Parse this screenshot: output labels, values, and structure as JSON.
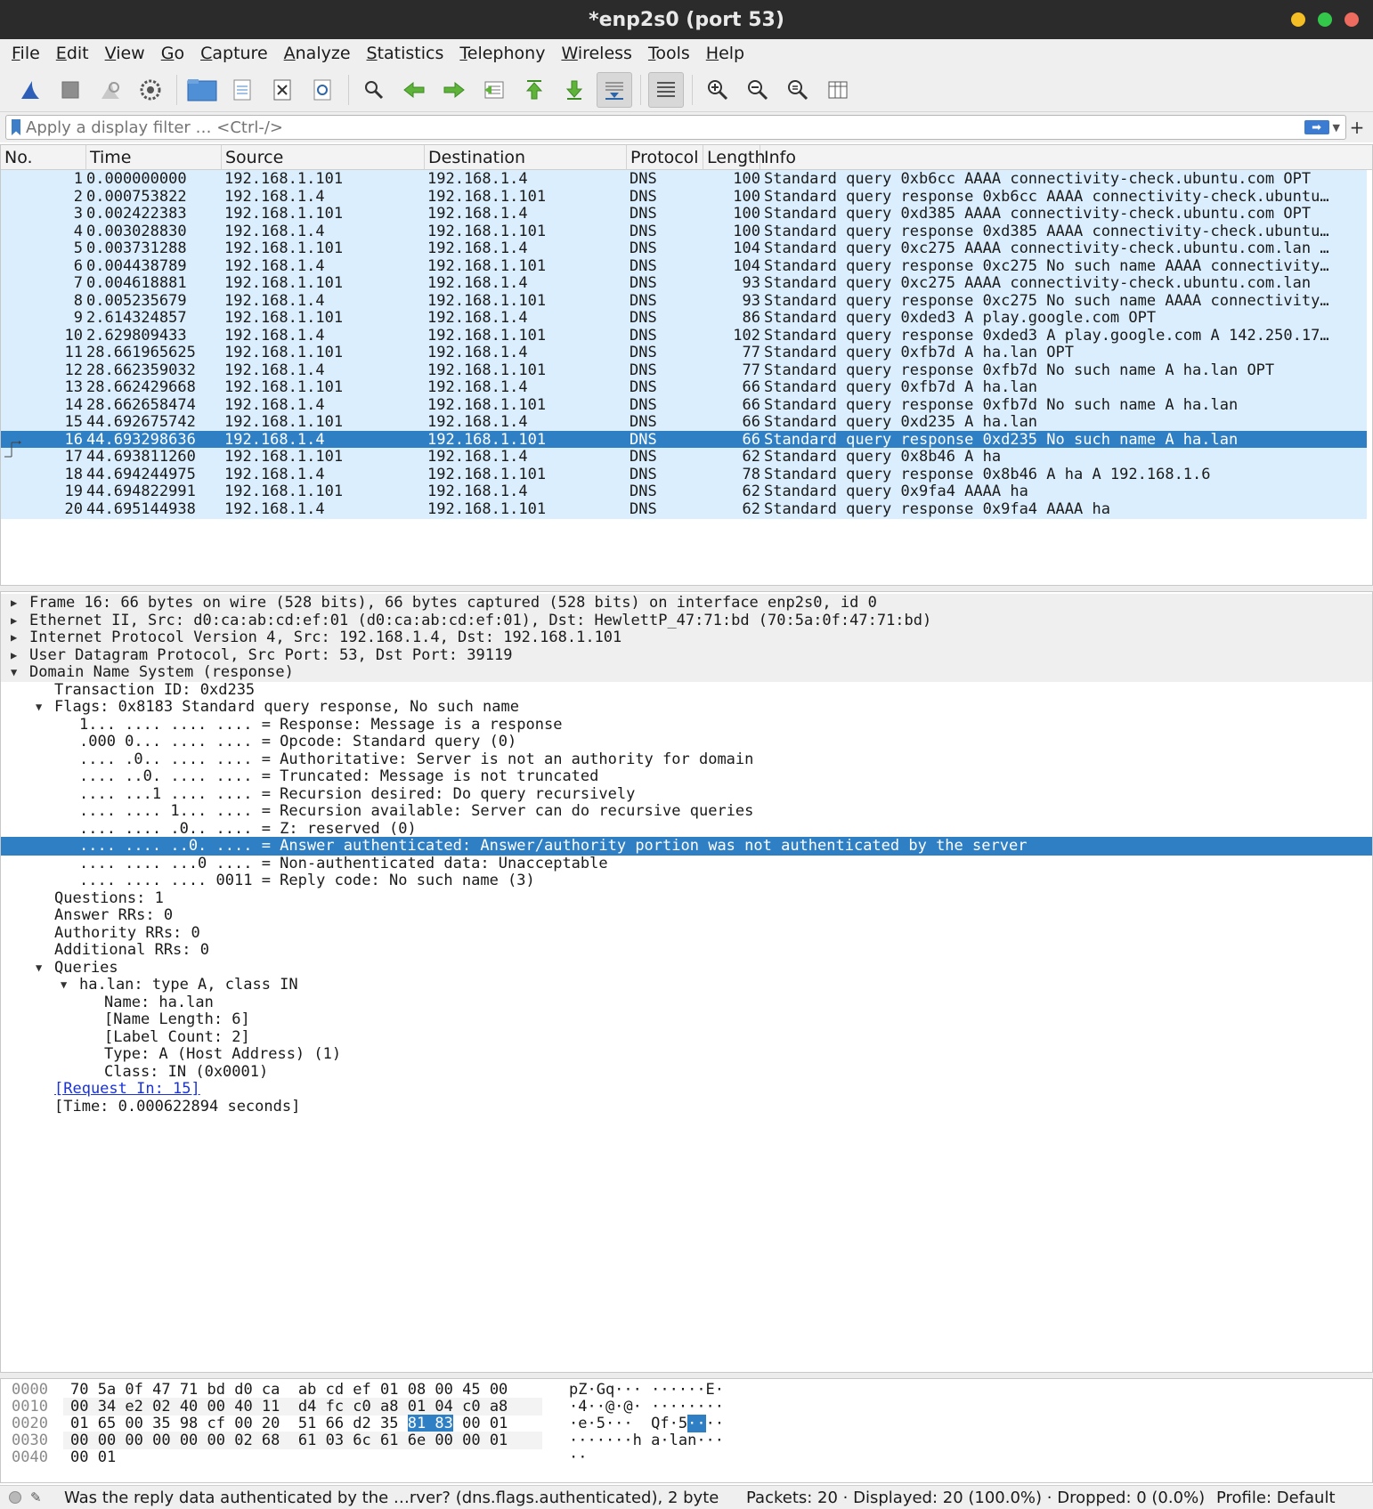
{
  "window": {
    "title": "*enp2s0 (port 53)",
    "colors": {
      "close": "#f4bf24",
      "max": "#34c84a",
      "min": "#ed6b5f"
    }
  },
  "menu": [
    {
      "label": "File",
      "u": "F",
      "rest": "ile"
    },
    {
      "label": "Edit",
      "u": "E",
      "rest": "dit"
    },
    {
      "label": "View",
      "u": "V",
      "rest": "iew"
    },
    {
      "label": "Go",
      "u": "G",
      "rest": "o"
    },
    {
      "label": "Capture",
      "u": "C",
      "rest": "apture"
    },
    {
      "label": "Analyze",
      "u": "A",
      "rest": "nalyze"
    },
    {
      "label": "Statistics",
      "u": "S",
      "rest": "tatistics"
    },
    {
      "label": "Telephony",
      "u": "T",
      "rest": "elephony"
    },
    {
      "label": "Wireless",
      "u": "W",
      "rest": "ireless"
    },
    {
      "label": "Tools",
      "u": "T",
      "rest": "ools"
    },
    {
      "label": "Help",
      "u": "H",
      "rest": "elp"
    }
  ],
  "filter": {
    "placeholder": "Apply a display filter … <Ctrl-/>"
  },
  "packet_list": {
    "columns": [
      "No.",
      "Time",
      "Source",
      "Destination",
      "Protocol",
      "Length",
      "Info"
    ],
    "selected_index": 15,
    "rows": [
      {
        "no": "1",
        "time": "0.000000000",
        "src": "192.168.1.101",
        "dst": "192.168.1.4",
        "proto": "DNS",
        "len": "100",
        "info": "Standard query 0xb6cc AAAA connectivity-check.ubuntu.com OPT"
      },
      {
        "no": "2",
        "time": "0.000753822",
        "src": "192.168.1.4",
        "dst": "192.168.1.101",
        "proto": "DNS",
        "len": "100",
        "info": "Standard query response 0xb6cc AAAA connectivity-check.ubuntu…"
      },
      {
        "no": "3",
        "time": "0.002422383",
        "src": "192.168.1.101",
        "dst": "192.168.1.4",
        "proto": "DNS",
        "len": "100",
        "info": "Standard query 0xd385 AAAA connectivity-check.ubuntu.com OPT"
      },
      {
        "no": "4",
        "time": "0.003028830",
        "src": "192.168.1.4",
        "dst": "192.168.1.101",
        "proto": "DNS",
        "len": "100",
        "info": "Standard query response 0xd385 AAAA connectivity-check.ubuntu…"
      },
      {
        "no": "5",
        "time": "0.003731288",
        "src": "192.168.1.101",
        "dst": "192.168.1.4",
        "proto": "DNS",
        "len": "104",
        "info": "Standard query 0xc275 AAAA connectivity-check.ubuntu.com.lan …"
      },
      {
        "no": "6",
        "time": "0.004438789",
        "src": "192.168.1.4",
        "dst": "192.168.1.101",
        "proto": "DNS",
        "len": "104",
        "info": "Standard query response 0xc275 No such name AAAA connectivity…"
      },
      {
        "no": "7",
        "time": "0.004618881",
        "src": "192.168.1.101",
        "dst": "192.168.1.4",
        "proto": "DNS",
        "len": "93",
        "info": "Standard query 0xc275 AAAA connectivity-check.ubuntu.com.lan"
      },
      {
        "no": "8",
        "time": "0.005235679",
        "src": "192.168.1.4",
        "dst": "192.168.1.101",
        "proto": "DNS",
        "len": "93",
        "info": "Standard query response 0xc275 No such name AAAA connectivity…"
      },
      {
        "no": "9",
        "time": "2.614324857",
        "src": "192.168.1.101",
        "dst": "192.168.1.4",
        "proto": "DNS",
        "len": "86",
        "info": "Standard query 0xded3 A play.google.com OPT"
      },
      {
        "no": "10",
        "time": "2.629809433",
        "src": "192.168.1.4",
        "dst": "192.168.1.101",
        "proto": "DNS",
        "len": "102",
        "info": "Standard query response 0xded3 A play.google.com A 142.250.17…"
      },
      {
        "no": "11",
        "time": "28.661965625",
        "src": "192.168.1.101",
        "dst": "192.168.1.4",
        "proto": "DNS",
        "len": "77",
        "info": "Standard query 0xfb7d A ha.lan OPT"
      },
      {
        "no": "12",
        "time": "28.662359032",
        "src": "192.168.1.4",
        "dst": "192.168.1.101",
        "proto": "DNS",
        "len": "77",
        "info": "Standard query response 0xfb7d No such name A ha.lan OPT"
      },
      {
        "no": "13",
        "time": "28.662429668",
        "src": "192.168.1.101",
        "dst": "192.168.1.4",
        "proto": "DNS",
        "len": "66",
        "info": "Standard query 0xfb7d A ha.lan"
      },
      {
        "no": "14",
        "time": "28.662658474",
        "src": "192.168.1.4",
        "dst": "192.168.1.101",
        "proto": "DNS",
        "len": "66",
        "info": "Standard query response 0xfb7d No such name A ha.lan"
      },
      {
        "no": "15",
        "time": "44.692675742",
        "src": "192.168.1.101",
        "dst": "192.168.1.4",
        "proto": "DNS",
        "len": "66",
        "info": "Standard query 0xd235 A ha.lan"
      },
      {
        "no": "16",
        "time": "44.693298636",
        "src": "192.168.1.4",
        "dst": "192.168.1.101",
        "proto": "DNS",
        "len": "66",
        "info": "Standard query response 0xd235 No such name A ha.lan"
      },
      {
        "no": "17",
        "time": "44.693811260",
        "src": "192.168.1.101",
        "dst": "192.168.1.4",
        "proto": "DNS",
        "len": "62",
        "info": "Standard query 0x8b46 A ha"
      },
      {
        "no": "18",
        "time": "44.694244975",
        "src": "192.168.1.4",
        "dst": "192.168.1.101",
        "proto": "DNS",
        "len": "78",
        "info": "Standard query response 0x8b46 A ha A 192.168.1.6"
      },
      {
        "no": "19",
        "time": "44.694822991",
        "src": "192.168.1.101",
        "dst": "192.168.1.4",
        "proto": "DNS",
        "len": "62",
        "info": "Standard query 0x9fa4 AAAA ha"
      },
      {
        "no": "20",
        "time": "44.695144938",
        "src": "192.168.1.4",
        "dst": "192.168.1.101",
        "proto": "DNS",
        "len": "62",
        "info": "Standard query response 0x9fa4 AAAA ha"
      }
    ]
  },
  "detail": [
    {
      "text": "Frame 16: 66 bytes on wire (528 bits), 66 bytes captured (528 bits) on interface enp2s0, id 0",
      "level": 0,
      "arrow": "collapsed",
      "top": true
    },
    {
      "text": "Ethernet II, Src: d0:ca:ab:cd:ef:01 (d0:ca:ab:cd:ef:01), Dst: HewlettP_47:71:bd (70:5a:0f:47:71:bd)",
      "level": 0,
      "arrow": "collapsed",
      "top": true
    },
    {
      "text": "Internet Protocol Version 4, Src: 192.168.1.4, Dst: 192.168.1.101",
      "level": 0,
      "arrow": "collapsed",
      "top": true
    },
    {
      "text": "User Datagram Protocol, Src Port: 53, Dst Port: 39119",
      "level": 0,
      "arrow": "collapsed",
      "top": true
    },
    {
      "text": "Domain Name System (response)",
      "level": 0,
      "arrow": "expanded",
      "top": true
    },
    {
      "text": "Transaction ID: 0xd235",
      "level": 1
    },
    {
      "text": "Flags: 0x8183 Standard query response, No such name",
      "level": 1,
      "arrow": "expanded"
    },
    {
      "text": "1... .... .... .... = Response: Message is a response",
      "level": 2
    },
    {
      "text": ".000 0... .... .... = Opcode: Standard query (0)",
      "level": 2
    },
    {
      "text": ".... .0.. .... .... = Authoritative: Server is not an authority for domain",
      "level": 2
    },
    {
      "text": ".... ..0. .... .... = Truncated: Message is not truncated",
      "level": 2
    },
    {
      "text": ".... ...1 .... .... = Recursion desired: Do query recursively",
      "level": 2
    },
    {
      "text": ".... .... 1... .... = Recursion available: Server can do recursive queries",
      "level": 2
    },
    {
      "text": ".... .... .0.. .... = Z: reserved (0)",
      "level": 2
    },
    {
      "text": ".... .... ..0. .... = Answer authenticated: Answer/authority portion was not authenticated by the server",
      "level": 2,
      "selected": true
    },
    {
      "text": ".... .... ...0 .... = Non-authenticated data: Unacceptable",
      "level": 2
    },
    {
      "text": ".... .... .... 0011 = Reply code: No such name (3)",
      "level": 2
    },
    {
      "text": "Questions: 1",
      "level": 1
    },
    {
      "text": "Answer RRs: 0",
      "level": 1
    },
    {
      "text": "Authority RRs: 0",
      "level": 1
    },
    {
      "text": "Additional RRs: 0",
      "level": 1
    },
    {
      "text": "Queries",
      "level": 1,
      "arrow": "expanded"
    },
    {
      "text": "ha.lan: type A, class IN",
      "level": 2,
      "arrow": "expanded"
    },
    {
      "text": "Name: ha.lan",
      "level": 3
    },
    {
      "text": "[Name Length: 6]",
      "level": 3
    },
    {
      "text": "[Label Count: 2]",
      "level": 3
    },
    {
      "text": "Type: A (Host Address) (1)",
      "level": 3
    },
    {
      "text": "Class: IN (0x0001)",
      "level": 3
    },
    {
      "text": "[Request In: 15]",
      "level": 1,
      "link": true
    },
    {
      "text": "[Time: 0.000622894 seconds]",
      "level": 1
    }
  ],
  "hex": [
    {
      "off": "0000",
      "b1": "70 5a 0f 47 71 bd d0 ca",
      "b2": "ab cd ef 01 08 00 45 00",
      "a1": "pZ·Gq···",
      "a2": "······E·"
    },
    {
      "off": "0010",
      "b1": "00 34 e2 02 40 00 40 11",
      "b2": "d4 fc c0 a8 01 04 c0 a8",
      "a1": "·4··@·@·",
      "a2": "········"
    },
    {
      "off": "0020",
      "b1": "01 65 00 35 98 cf 00 20",
      "b2_pre": "51 66 d2 35 ",
      "b2_hl": "81 83",
      "b2_post": " 00 01",
      "a1": "·e·5··· ",
      "a2_pre": "Qf·5",
      "a2_hl": "··",
      "a2_post": "··"
    },
    {
      "off": "0030",
      "b1": "00 00 00 00 00 00 02 68",
      "b2": "61 03 6c 61 6e 00 00 01",
      "a1": "·······h",
      "a2": "a·lan···"
    },
    {
      "off": "0040",
      "b1": "00 01",
      "b2": "",
      "a1": "··",
      "a2": ""
    }
  ],
  "status": {
    "field_info": "Was the reply data authenticated by the …rver? (dns.flags.authenticated), 2 byte",
    "packets": "Packets: 20 · Displayed: 20 (100.0%) · Dropped: 0 (0.0%)",
    "profile": "Profile: Default"
  }
}
